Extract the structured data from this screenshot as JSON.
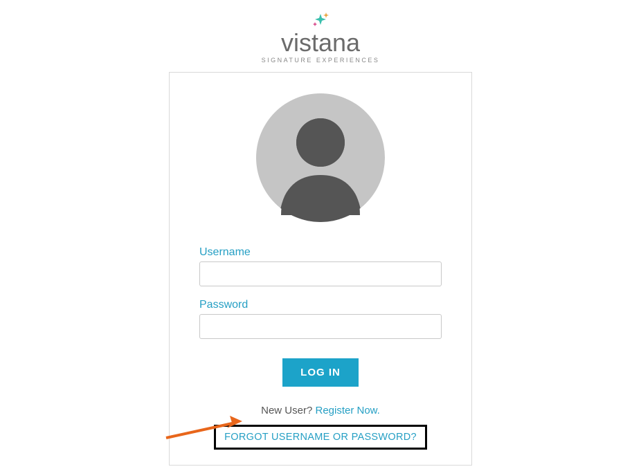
{
  "brand": {
    "name": "vistana",
    "tagline": "SIGNATURE EXPERIENCES"
  },
  "form": {
    "username_label": "Username",
    "password_label": "Password",
    "login_button": "LOG IN"
  },
  "links": {
    "new_user_prefix": "New User? ",
    "register": "Register Now.",
    "forgot": "FORGOT USERNAME OR PASSWORD?"
  },
  "colors": {
    "accent": "#259fc4",
    "button": "#1ca3c9"
  }
}
